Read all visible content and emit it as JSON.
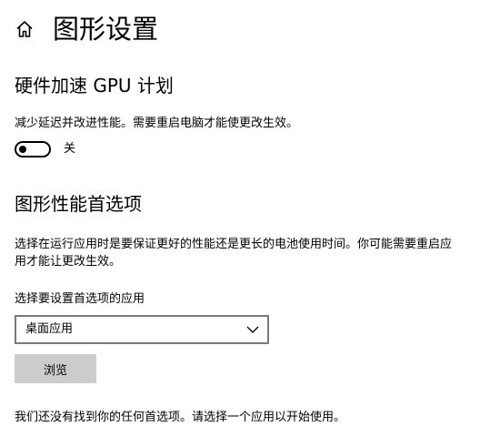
{
  "header": {
    "title": "图形设置",
    "home_icon": "home-icon"
  },
  "gpu_scheduling": {
    "title": "硬件加速 GPU 计划",
    "description": "减少延迟并改进性能。需要重启电脑才能使更改生效。",
    "toggle_state": "关"
  },
  "preferences": {
    "title": "图形性能首选项",
    "description": "选择在运行应用时是要保证更好的性能还是更长的电池使用时间。你可能需要重启应用才能让更改生效。",
    "select_label": "选择要设置首选项的应用",
    "selected_app_type": "桌面应用",
    "browse_label": "浏览",
    "empty_message": "我们还没有找到你的任何首选项。请选择一个应用以开始使用。"
  },
  "colors": {
    "background": "#ffffff",
    "text": "#000000",
    "button_bg": "#cccccc",
    "select_border": "#7a7a7a"
  }
}
